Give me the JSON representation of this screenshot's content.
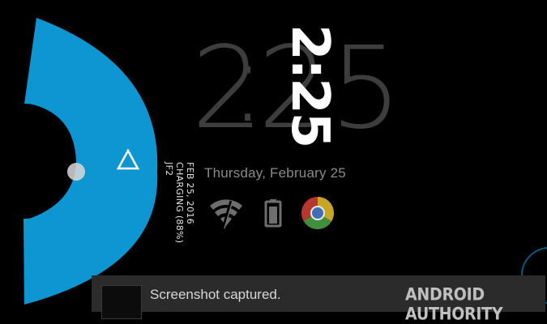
{
  "lockscreen": {
    "big_clock": {
      "hours": "2",
      "colon": ":",
      "minutes": "25"
    },
    "date": "Thursday, February 25"
  },
  "widget": {
    "time": "2:25",
    "date_line": "FEB 25, 2016",
    "charging_line": "CHARGING (88%)",
    "extra_line": "JF2"
  },
  "status_icons": [
    "wifi-icon",
    "battery-icon",
    "chrome-icon"
  ],
  "pie_menu": {
    "color": "#0d96d1",
    "items": [
      "circle-icon",
      "triangle-icon"
    ]
  },
  "toast": {
    "message": "Screenshot captured."
  },
  "watermark": {
    "text": "ANDROID AUTHORITY"
  }
}
